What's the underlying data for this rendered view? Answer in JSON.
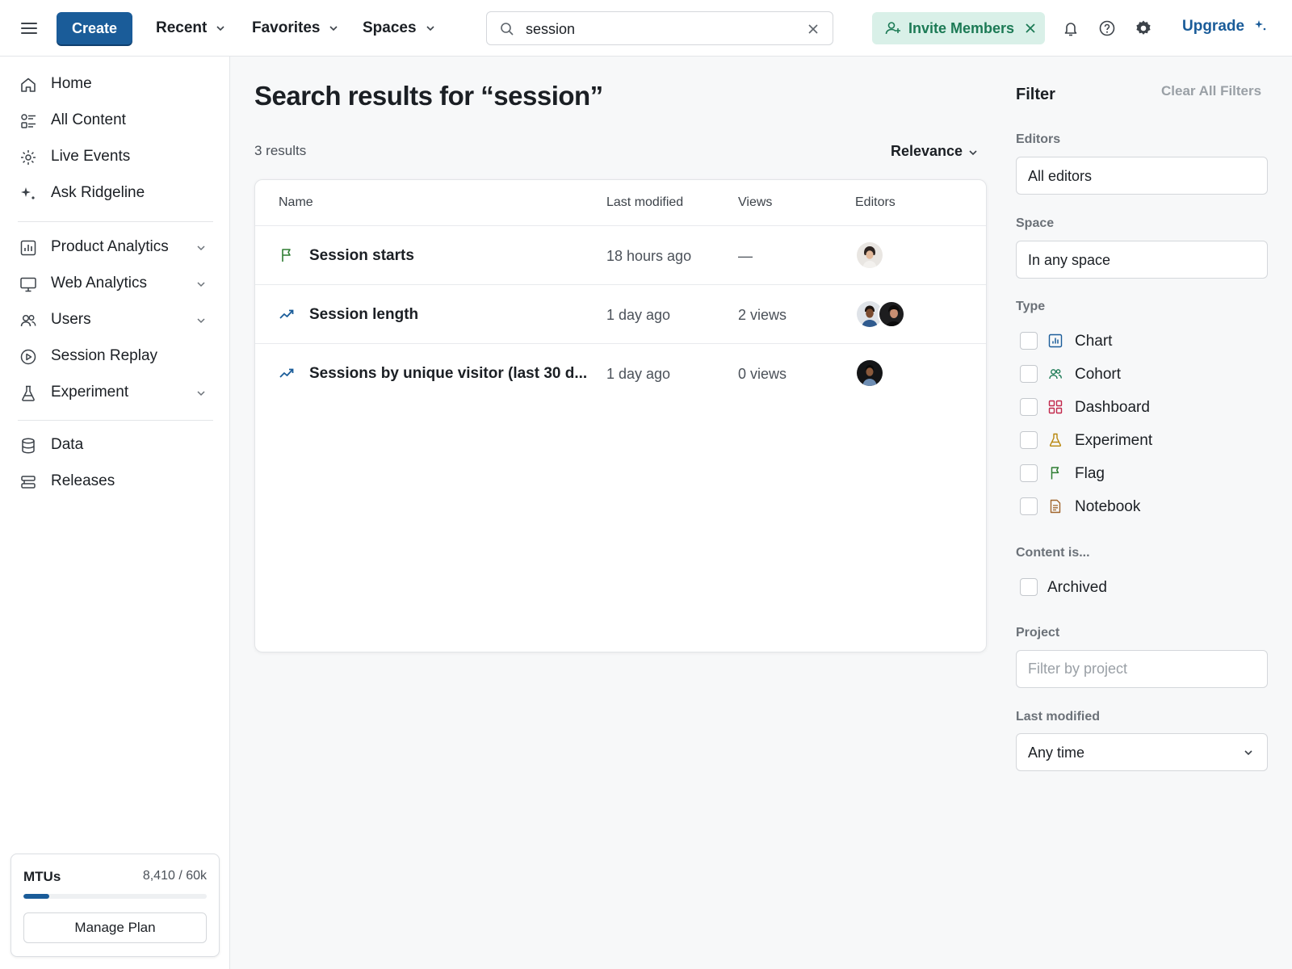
{
  "topbar": {
    "create_label": "Create",
    "nav": [
      {
        "label": "Recent"
      },
      {
        "label": "Favorites"
      },
      {
        "label": "Spaces"
      }
    ],
    "search_value": "session",
    "invite_label": "Invite Members",
    "upgrade_label": "Upgrade",
    "accent_color": "#1a5c99",
    "invite_color": "#1c7a55"
  },
  "sidebar": {
    "items": [
      {
        "label": "Home",
        "icon": "home-icon"
      },
      {
        "label": "All Content",
        "icon": "all-content-icon"
      },
      {
        "label": "Live Events",
        "icon": "live-events-icon"
      },
      {
        "label": "Ask Ridgeline",
        "icon": "sparkle-icon"
      },
      {
        "label": "Product Analytics",
        "icon": "bar-chart-icon"
      },
      {
        "label": "Web Analytics",
        "icon": "monitor-icon"
      },
      {
        "label": "Users",
        "icon": "users-icon"
      },
      {
        "label": "Session Replay",
        "icon": "play-circle-icon"
      },
      {
        "label": "Experiment",
        "icon": "flask-icon"
      },
      {
        "label": "Data",
        "icon": "database-icon"
      },
      {
        "label": "Releases",
        "icon": "releases-icon"
      }
    ],
    "mtu": {
      "title": "MTUs",
      "value": "8,410 / 60k",
      "used": 8410,
      "limit": 60000,
      "manage_label": "Manage Plan"
    }
  },
  "main": {
    "title": "Search results for “session”",
    "result_count": "3 results",
    "sort_label": "Relevance",
    "columns": [
      "Name",
      "Last modified",
      "Views",
      "Editors"
    ],
    "rows": [
      {
        "name": "Session starts",
        "type_icon": "flag-icon",
        "modified": "18 hours ago",
        "views": "—",
        "editors": 1
      },
      {
        "name": "Session length",
        "type_icon": "trend-chart-icon",
        "modified": "1 day ago",
        "views": "2 views",
        "editors": 2
      },
      {
        "name": "Sessions by unique visitor (last 30 d...",
        "type_icon": "trend-chart-icon",
        "modified": "1 day ago",
        "views": "0 views",
        "editors": 1
      }
    ]
  },
  "filter": {
    "title": "Filter",
    "clear_label": "Clear All Filters",
    "editors_label": "Editors",
    "editors_value": "All editors",
    "space_label": "Space",
    "space_value": "In any space",
    "type_label": "Type",
    "types": [
      {
        "label": "Chart",
        "icon": "chart-icon",
        "color": "#1a5c99"
      },
      {
        "label": "Cohort",
        "icon": "cohort-icon",
        "color": "#1c7a55"
      },
      {
        "label": "Dashboard",
        "icon": "dashboard-icon",
        "color": "#c2274b"
      },
      {
        "label": "Experiment",
        "icon": "flask-icon",
        "color": "#b8860b"
      },
      {
        "label": "Flag",
        "icon": "flag-icon",
        "color": "#2e7d32"
      },
      {
        "label": "Notebook",
        "icon": "notebook-icon",
        "color": "#a0642b"
      }
    ],
    "content_label": "Content is...",
    "archived_label": "Archived",
    "project_label": "Project",
    "project_placeholder": "Filter by project",
    "modified_label": "Last modified",
    "modified_value": "Any time"
  }
}
